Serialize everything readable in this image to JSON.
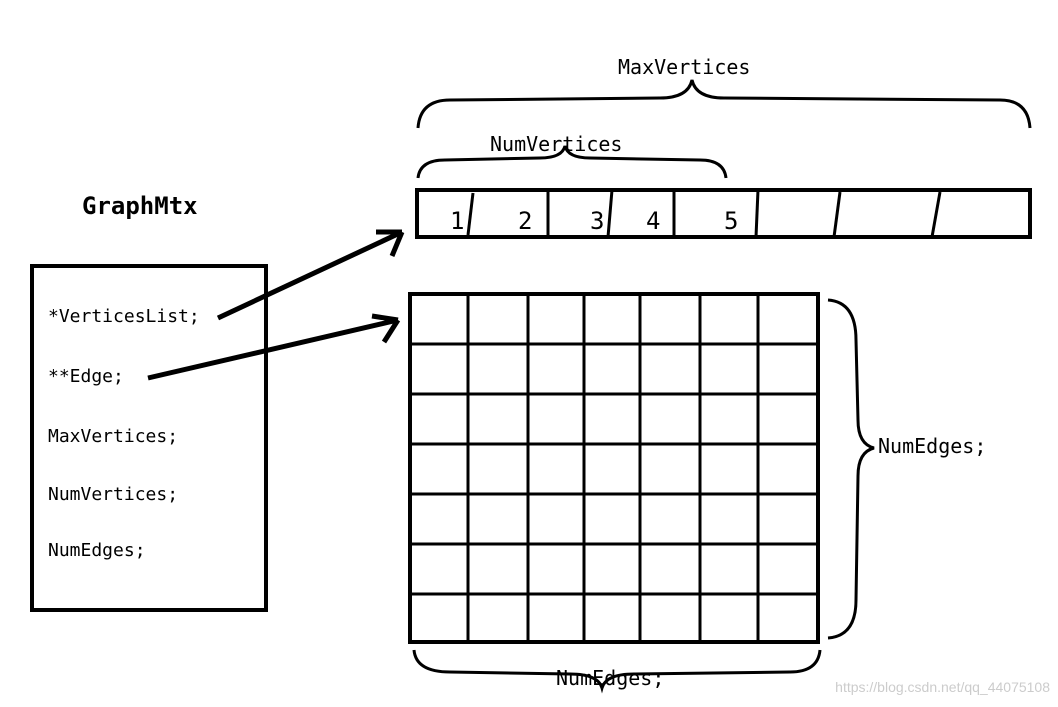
{
  "title": "GraphMtx",
  "struct_fields": {
    "vertices_list": "*VerticesList;",
    "edge": "**Edge;",
    "max_vertices": "MaxVertices;",
    "num_vertices": "NumVertices;",
    "num_edges": "NumEdges;"
  },
  "labels": {
    "max_vertices": "MaxVertices",
    "num_vertices": "NumVertices",
    "num_edges_right": "NumEdges;",
    "num_edges_bottom": "NumEdges;"
  },
  "array_values": [
    "1",
    "2",
    "3",
    "4",
    "5"
  ],
  "watermark": "https://blog.csdn.net/qq_44075108"
}
